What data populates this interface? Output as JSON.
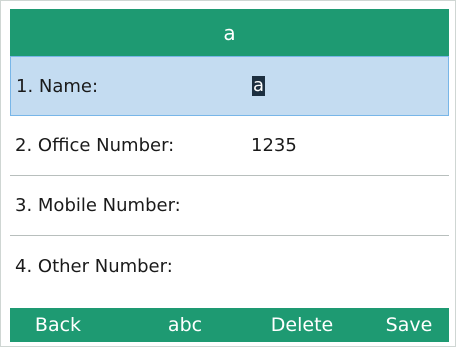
{
  "header": {
    "title": "a"
  },
  "fields": [
    {
      "label": "1. Name:",
      "value": "a"
    },
    {
      "label": "2. Office Number:",
      "value": "1235"
    },
    {
      "label": "3. Mobile Number:",
      "value": ""
    },
    {
      "label": "4. Other Number:",
      "value": ""
    }
  ],
  "softkeys": {
    "back": "Back",
    "input_mode": "abc",
    "delete": "Delete",
    "save": "Save"
  },
  "colors": {
    "bar": "#1e9a72",
    "selected_row": "#c4dcf1",
    "selected_border": "#78b6e8"
  }
}
